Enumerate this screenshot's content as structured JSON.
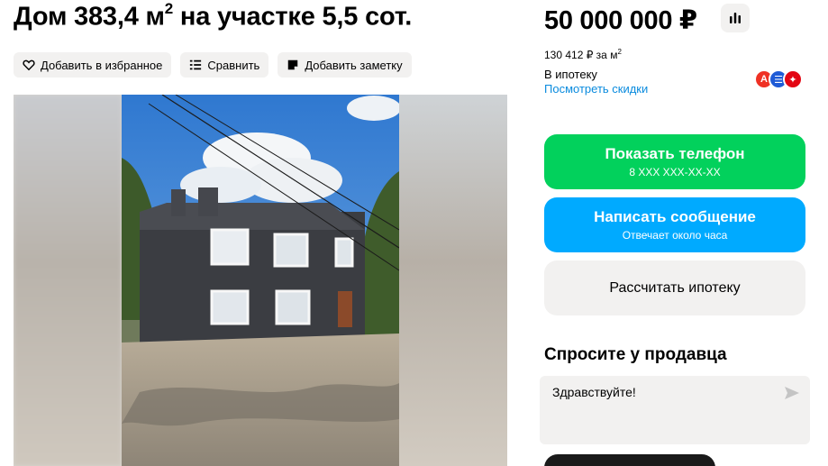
{
  "listing": {
    "title_main": "Дом 383,4 м",
    "title_sup": "2",
    "title_rest": " на участке 5,5 сот."
  },
  "actions": {
    "favorite": "Добавить в избранное",
    "compare": "Сравнить",
    "note": "Добавить заметку"
  },
  "price": {
    "value": "50 000 000 ₽",
    "per_meter": "130 412 ₽ за м",
    "per_meter_sup": "2",
    "mortgage_label": "В ипотеку",
    "discounts_link": "Посмотреть скидки"
  },
  "banks": [
    {
      "icon": "alfa-bank-icon",
      "glyph": "А",
      "color": "#ef3124"
    },
    {
      "icon": "sber-icon",
      "glyph": "☰",
      "color": "#1f5bd6"
    },
    {
      "icon": "bank-icon",
      "glyph": "✦",
      "color": "#e30613"
    }
  ],
  "buttons": {
    "phone_main": "Показать телефон",
    "phone_sub": "8 XXX XXX-XX-XX",
    "message_main": "Написать сообщение",
    "message_sub": "Отвечает около часа",
    "mortgage": "Рассчитать ипотеку"
  },
  "ask": {
    "title": "Спросите у продавца",
    "value": "Здравствуйте!"
  },
  "colors": {
    "phone_btn": "#02d15c",
    "message_btn": "#00aaff",
    "link": "#0a8bde",
    "chip_bg": "#f2f1f0"
  }
}
